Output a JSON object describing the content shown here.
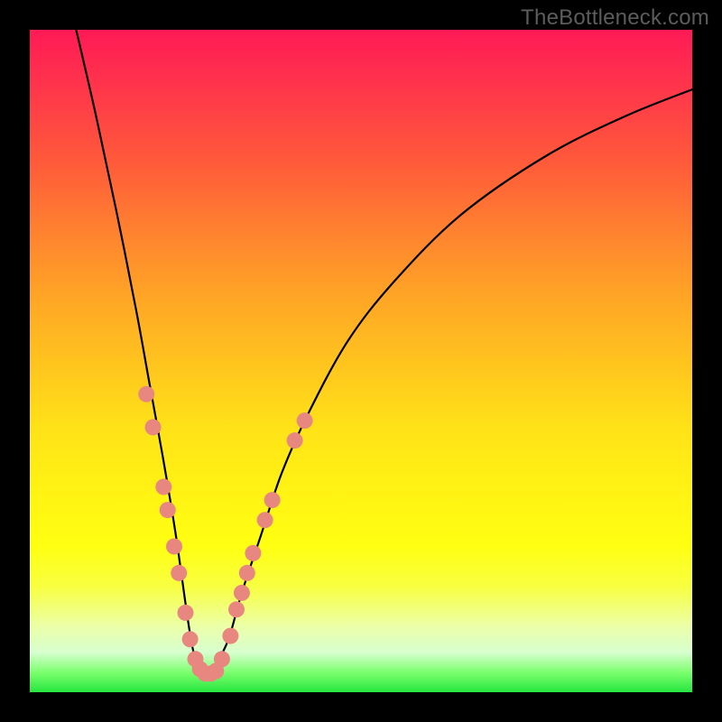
{
  "watermark": "TheBottleneck.com",
  "colors": {
    "frame": "#000000",
    "curve": "#000000",
    "dots": "#e88680",
    "gradient_top": "#ff1a56",
    "gradient_bottom": "#26e63f"
  },
  "chart_data": {
    "type": "line",
    "title": "",
    "xlabel": "",
    "ylabel": "",
    "xlim": [
      0,
      100
    ],
    "ylim": [
      0,
      100
    ],
    "series": [
      {
        "name": "bottleneck-curve",
        "description": "V-shaped bottleneck curve: steep descent from top-left, minimum near x≈25, asymptotic rise toward right. Y is approximate percent height read from image.",
        "x": [
          7,
          10,
          13,
          16,
          18,
          20,
          22,
          24,
          25,
          26,
          27,
          28,
          30,
          32,
          35,
          38,
          42,
          48,
          55,
          65,
          78,
          90,
          100
        ],
        "y": [
          100,
          87,
          73,
          58,
          47,
          36,
          24,
          10,
          5,
          3,
          3,
          4,
          8,
          15,
          24,
          33,
          42,
          53,
          62,
          72,
          81,
          87,
          91
        ]
      }
    ],
    "markers": {
      "name": "highlighted-points",
      "description": "Salmon dots clustered on both arms near the trough of the curve.",
      "points": [
        {
          "x": 17.6,
          "y": 45.0
        },
        {
          "x": 18.6,
          "y": 40.0
        },
        {
          "x": 20.2,
          "y": 31.0
        },
        {
          "x": 20.8,
          "y": 27.5
        },
        {
          "x": 21.8,
          "y": 22.0
        },
        {
          "x": 22.5,
          "y": 18.0
        },
        {
          "x": 23.5,
          "y": 12.0
        },
        {
          "x": 24.2,
          "y": 8.0
        },
        {
          "x": 25.0,
          "y": 5.0
        },
        {
          "x": 25.7,
          "y": 3.5
        },
        {
          "x": 26.5,
          "y": 2.8
        },
        {
          "x": 27.3,
          "y": 2.8
        },
        {
          "x": 28.1,
          "y": 3.2
        },
        {
          "x": 29.0,
          "y": 5.0
        },
        {
          "x": 30.3,
          "y": 8.5
        },
        {
          "x": 31.2,
          "y": 12.5
        },
        {
          "x": 32.0,
          "y": 15.0
        },
        {
          "x": 32.8,
          "y": 18.0
        },
        {
          "x": 33.7,
          "y": 21.0
        },
        {
          "x": 35.5,
          "y": 26.0
        },
        {
          "x": 36.6,
          "y": 29.0
        },
        {
          "x": 40.0,
          "y": 38.0
        },
        {
          "x": 41.5,
          "y": 41.0
        }
      ]
    }
  }
}
